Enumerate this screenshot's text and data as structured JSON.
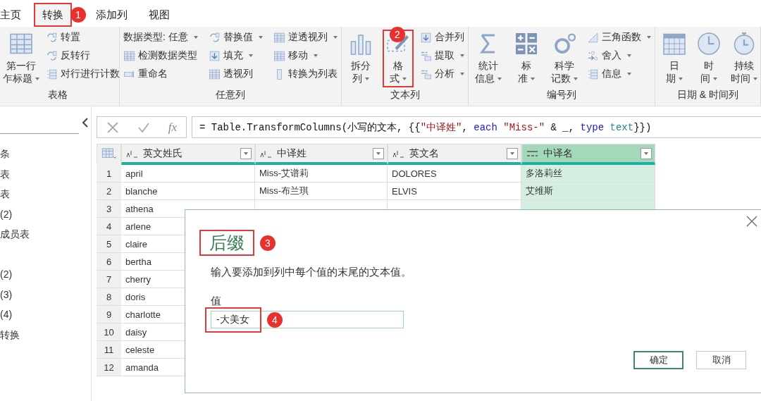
{
  "tabs": [
    {
      "label": "主页",
      "selected": false
    },
    {
      "label": "转换",
      "selected": true,
      "callout": "1"
    },
    {
      "label": "添加列",
      "selected": false
    },
    {
      "label": "视图",
      "selected": false
    }
  ],
  "ribbon": {
    "groups": [
      {
        "label": "表格",
        "big": [
          {
            "lines": [
              "第一行",
              "乍标题"
            ],
            "dropdown": true
          }
        ],
        "columns": [
          [
            {
              "label": "转置",
              "dropdown": false
            },
            {
              "label": "反转行",
              "dropdown": false
            },
            {
              "label": "对行进行计数",
              "dropdown": false
            }
          ]
        ]
      },
      {
        "label": "任意列",
        "columns": [
          [
            {
              "label": "数据类型: 任意",
              "dropdown": true
            },
            {
              "label": "检测数据类型",
              "dropdown": false
            },
            {
              "label": "重命名",
              "dropdown": false
            }
          ],
          [
            {
              "label": "替换值",
              "dropdown": true
            },
            {
              "label": "填充",
              "dropdown": true
            },
            {
              "label": "透视列",
              "dropdown": false
            }
          ],
          [
            {
              "label": "逆透视列",
              "dropdown": true
            },
            {
              "label": "移动",
              "dropdown": true
            },
            {
              "label": "转换为列表",
              "dropdown": false
            }
          ]
        ]
      },
      {
        "label": "文本列",
        "big": [
          {
            "lines": [
              "拆分",
              "列"
            ],
            "dropdown": true
          },
          {
            "lines": [
              "格",
              "式"
            ],
            "dropdown": true,
            "callout": "2"
          }
        ],
        "columns": [
          [
            {
              "label": "合并列",
              "dropdown": false
            },
            {
              "label": "提取",
              "dropdown": true
            },
            {
              "label": "分析",
              "dropdown": true
            }
          ]
        ]
      },
      {
        "label": "编号列",
        "big": [
          {
            "lines": [
              "统计",
              "信息"
            ],
            "dropdown": true
          },
          {
            "lines": [
              "标",
              "准"
            ],
            "dropdown": true
          },
          {
            "lines": [
              "科学",
              "记数"
            ],
            "dropdown": true
          }
        ],
        "columns": [
          [
            {
              "label": "三角函数",
              "dropdown": true
            },
            {
              "label": "舍入",
              "dropdown": true
            },
            {
              "label": "信息",
              "dropdown": true
            }
          ]
        ]
      },
      {
        "label": "日期 & 时间列",
        "big": [
          {
            "lines": [
              "日",
              "期"
            ],
            "dropdown": true
          },
          {
            "lines": [
              "时",
              "间"
            ],
            "dropdown": true
          },
          {
            "lines": [
              "持续",
              "时间"
            ],
            "dropdown": true
          }
        ]
      }
    ]
  },
  "queries": {
    "groups": [
      {
        "items": [
          "条",
          "表",
          "表",
          "(2)",
          "成员表"
        ]
      },
      {
        "items": [
          "(2)",
          "(3)",
          "(4)",
          "转换"
        ]
      }
    ]
  },
  "formula_bar": {
    "fx_label": "fx",
    "tokens": [
      {
        "kind": "plain",
        "text": "= Table.TransformColumns(小写的文本, {{"
      },
      {
        "kind": "string",
        "text": "\"中译姓\""
      },
      {
        "kind": "plain",
        "text": ", "
      },
      {
        "kind": "keyword",
        "text": "each "
      },
      {
        "kind": "string",
        "text": "\"Miss-\""
      },
      {
        "kind": "plain",
        "text": " & _, "
      },
      {
        "kind": "keyword",
        "text": "type "
      },
      {
        "kind": "typename",
        "text": "text"
      },
      {
        "kind": "plain",
        "text": "}})"
      }
    ]
  },
  "table": {
    "columns": [
      {
        "name": "英文姓氏",
        "kind": "text",
        "selected": false
      },
      {
        "name": "中译姓",
        "kind": "text",
        "selected": false
      },
      {
        "name": "英文名",
        "kind": "text",
        "selected": false
      },
      {
        "name": "中译名",
        "kind": "any",
        "selected": true
      }
    ],
    "rows": [
      {
        "number": "1",
        "cells": [
          "april",
          "Miss-艾谱莉",
          "DOLORES",
          "多洛莉丝"
        ]
      },
      {
        "number": "2",
        "cells": [
          "blanche",
          "Miss-布兰琪",
          "ELVIS",
          "艾维斯"
        ]
      },
      {
        "number": "3",
        "cells": [
          "athena"
        ]
      },
      {
        "number": "4",
        "cells": [
          "arlene"
        ]
      },
      {
        "number": "5",
        "cells": [
          "claire"
        ]
      },
      {
        "number": "6",
        "cells": [
          "bertha"
        ]
      },
      {
        "number": "7",
        "cells": [
          "cherry"
        ]
      },
      {
        "number": "8",
        "cells": [
          "doris"
        ]
      },
      {
        "number": "9",
        "cells": [
          "charlotte"
        ]
      },
      {
        "number": "10",
        "cells": [
          "daisy"
        ]
      },
      {
        "number": "11",
        "cells": [
          "celeste"
        ]
      },
      {
        "number": "12",
        "cells": [
          "amanda"
        ]
      }
    ]
  },
  "dialog": {
    "title": "后缀",
    "title_callout": "3",
    "description": "输入要添加到列中每个值的末尾的文本值。",
    "field_label": "值",
    "value": "-大美女",
    "value_callout": "4",
    "buttons": [
      {
        "label": "确定",
        "default": true
      },
      {
        "label": "取消",
        "default": false
      }
    ]
  }
}
